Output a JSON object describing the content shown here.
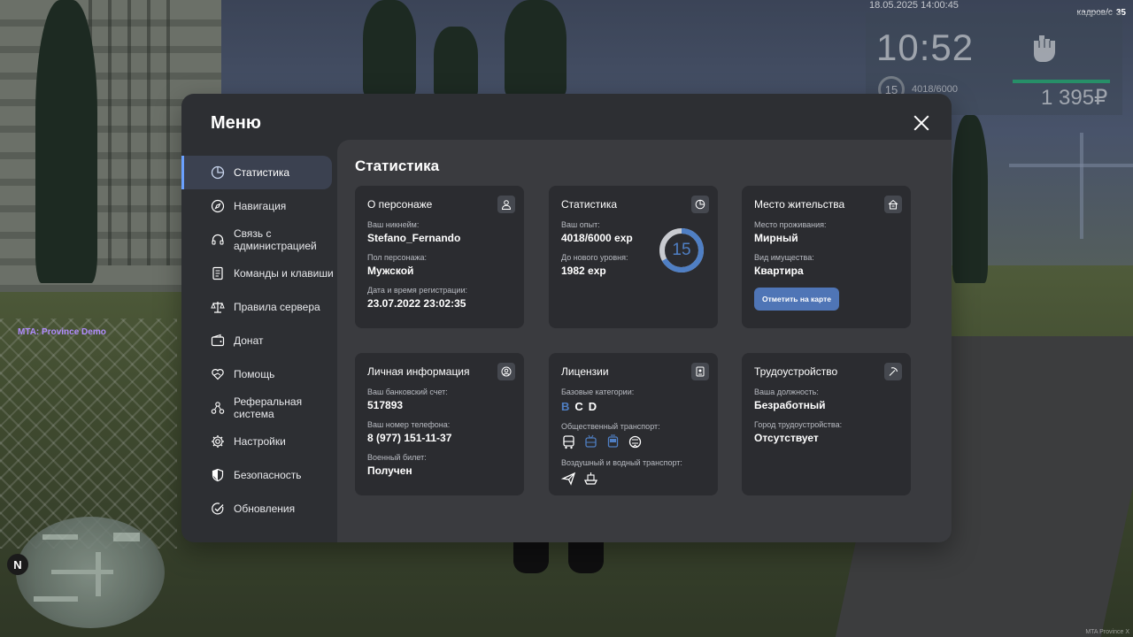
{
  "hud": {
    "datetime": "18.05.2025 14:00:45",
    "fps_label": "кадров/с",
    "fps_value": "35",
    "clock": "10:52",
    "level": "15",
    "exp": "4018/6000",
    "money": "1 395₽",
    "server_name": "MTA: Province Demo",
    "watermark": "MTA Province X",
    "minimap_north": "N"
  },
  "menu": {
    "title": "Меню",
    "sidebar": [
      {
        "label": "Статистика",
        "icon": "pie-chart-icon",
        "active": true
      },
      {
        "label": "Навигация",
        "icon": "compass-icon"
      },
      {
        "label": "Связь с администрацией",
        "icon": "headset-icon"
      },
      {
        "label": "Команды и клавиши",
        "icon": "document-icon"
      },
      {
        "label": "Правила сервера",
        "icon": "scales-icon"
      },
      {
        "label": "Донат",
        "icon": "wallet-icon"
      },
      {
        "label": "Помощь",
        "icon": "heart-hands-icon"
      },
      {
        "label": "Реферальная система",
        "icon": "share-nodes-icon"
      },
      {
        "label": "Настройки",
        "icon": "gear-icon"
      },
      {
        "label": "Безопасность",
        "icon": "shield-icon"
      },
      {
        "label": "Обновления",
        "icon": "check-circle-icon"
      }
    ]
  },
  "content": {
    "title": "Статистика",
    "character": {
      "title": "О персонаже",
      "nickname_label": "Ваш никнейм:",
      "nickname": "Stefano_Fernando",
      "gender_label": "Пол персонажа:",
      "gender": "Мужской",
      "reg_label": "Дата и время регистрации:",
      "reg_date": "23.07.2022 23:02:35"
    },
    "stats": {
      "title": "Статистика",
      "exp_label": "Ваш опыт:",
      "exp_value": "4018/6000 exp",
      "next_label": "До нового уровня:",
      "next_value": "1982 exp",
      "level": "15",
      "progress": 0.67,
      "accent_color": "#4f7fc4"
    },
    "residence": {
      "title": "Место жительства",
      "place_label": "Место проживания:",
      "place": "Мирный",
      "property_label": "Вид имущества:",
      "property": "Квартира",
      "button": "Отметить на карте"
    },
    "personal": {
      "title": "Личная информация",
      "bank_label": "Ваш банковский счет:",
      "bank": "517893",
      "phone_label": "Ваш номер телефона:",
      "phone": "8 (977) 151-11-37",
      "military_label": "Военный билет:",
      "military": "Получен"
    },
    "licenses": {
      "title": "Лицензии",
      "basic_label": "Базовые категории:",
      "categories": [
        {
          "letter": "B",
          "active": true
        },
        {
          "letter": "C",
          "active": false
        },
        {
          "letter": "D",
          "active": false
        }
      ],
      "public_label": "Общественный транспорт:",
      "public_icons": [
        "bus-icon",
        "trolleybus-icon",
        "tram-icon",
        "metro-icon"
      ],
      "air_water_label": "Воздушный и водный транспорт:",
      "air_water_icons": [
        "plane-icon",
        "ship-icon"
      ]
    },
    "employment": {
      "title": "Трудоустройство",
      "position_label": "Ваша должность:",
      "position": "Безработный",
      "city_label": "Город трудоустройства:",
      "city": "Отсутствует"
    }
  }
}
